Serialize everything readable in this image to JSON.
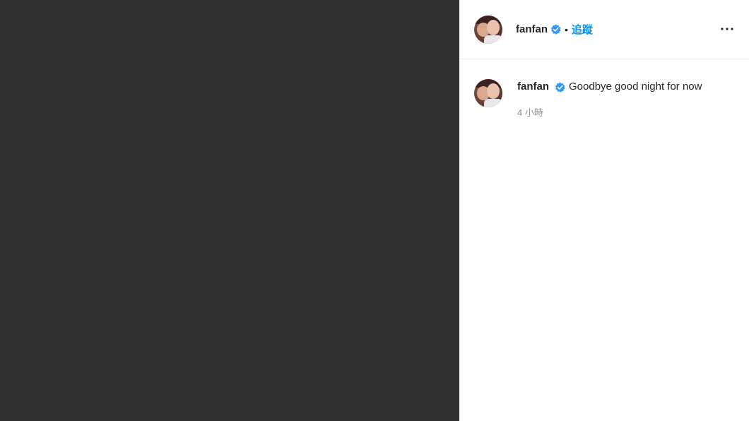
{
  "header": {
    "username": "fanfan",
    "separator": "•",
    "follow_label": "追蹤"
  },
  "caption": {
    "username": "fanfan",
    "text": "Goodbye good night for now",
    "timestamp": "4 小時"
  },
  "icons": {
    "verified": "verified-badge-icon",
    "more": "more-options-icon"
  },
  "colors": {
    "media_background": "#313131",
    "accent": "#0095f6",
    "verified": "#3897f0",
    "muted_text": "#8e8e8e"
  }
}
